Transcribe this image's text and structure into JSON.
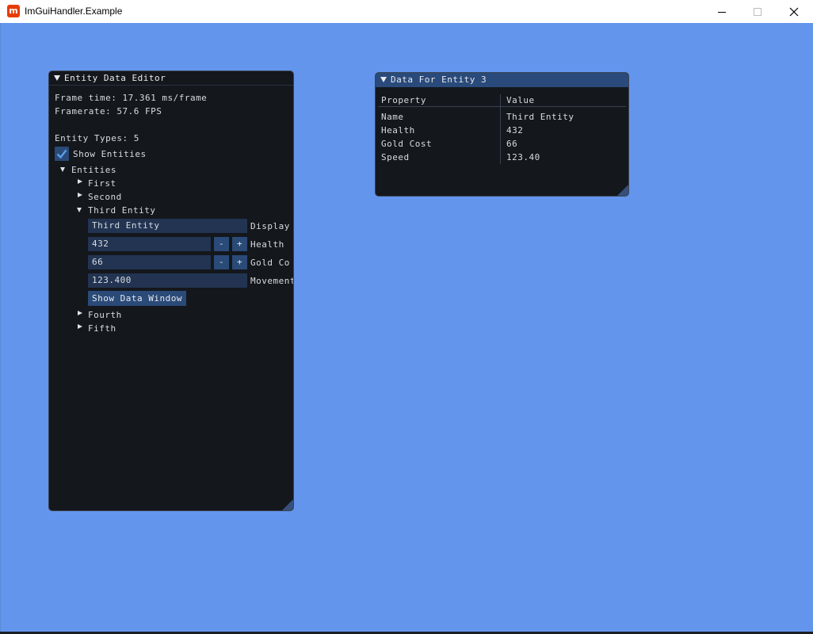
{
  "window": {
    "title": "ImGuiHandler.Example",
    "icon": "monogame-logo-icon",
    "background": "#6495ED"
  },
  "editor": {
    "title": "Entity Data Editor",
    "frame_time": "Frame time: 17.361 ms/frame",
    "framerate": "Framerate: 57.6 FPS",
    "entity_types": "Entity Types: 5",
    "show_entities_label": "Show Entities",
    "show_entities_checked": true,
    "entities_node": "Entities",
    "entities": [
      {
        "label": "First",
        "expanded": false
      },
      {
        "label": "Second",
        "expanded": false
      },
      {
        "label": "Third Entity",
        "expanded": true
      },
      {
        "label": "Fourth",
        "expanded": false
      },
      {
        "label": "Fifth",
        "expanded": false
      }
    ],
    "fields": {
      "display_value": "Third Entity",
      "display_label": "Display",
      "health_value": "432",
      "health_label": "Health",
      "gold_value": "66",
      "gold_label": "Gold Co",
      "movement_value": "123.400",
      "movement_label": "Movement",
      "minus": "-",
      "plus": "+"
    },
    "show_data_window_label": "Show Data Window"
  },
  "data_window": {
    "title": "Data For Entity 3",
    "columns": [
      "Property",
      "Value"
    ],
    "rows": [
      [
        "Name",
        "Third Entity"
      ],
      [
        "Health",
        "432"
      ],
      [
        "Gold Cost",
        "66"
      ],
      [
        "Speed",
        "123.40"
      ]
    ]
  }
}
